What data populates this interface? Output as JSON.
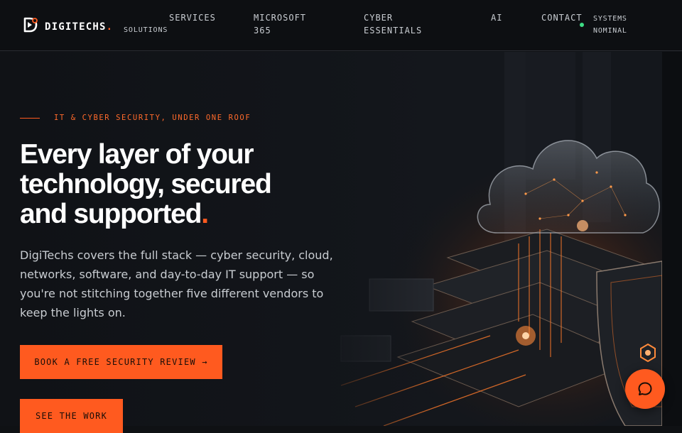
{
  "brand": {
    "name": "DIGITECHS",
    "dot": "."
  },
  "nav": {
    "items": [
      {
        "line1": "SERVICES",
        "line2": ""
      },
      {
        "line1": "SOLUTIONS",
        "line2": ""
      },
      {
        "line1": "MICROSOFT",
        "line2": "365"
      },
      {
        "line1": "CYBER",
        "line2": "ESSENTIALS"
      },
      {
        "line1": "AI",
        "line2": ""
      },
      {
        "line1": "CONTACT",
        "line2": ""
      }
    ]
  },
  "status": {
    "line1": "SYSTEMS",
    "line2": "NOMINAL",
    "color": "#3ddc84"
  },
  "hero": {
    "eyebrow": "IT & CYBER SECURITY, UNDER ONE ROOF",
    "headline": "Every layer of your technology, secured and supported",
    "headline_dot": ".",
    "lead": "DigiTechs covers the full stack — cyber security, cloud, networks, software, and day-to-day IT support — so you're not stitching together five different vendors to keep the lights on.",
    "primary_cta": "BOOK A FREE SECURITY REVIEW →",
    "secondary_cta": "SEE THE WORK"
  },
  "icons": {
    "logo": "digitechs-logo-icon",
    "chat": "chat-bubble-icon",
    "hero_image": "cloud-server-shield-illustration"
  },
  "colors": {
    "accent": "#ff5a1f",
    "background": "#0f1114",
    "text": "#ffffff"
  }
}
